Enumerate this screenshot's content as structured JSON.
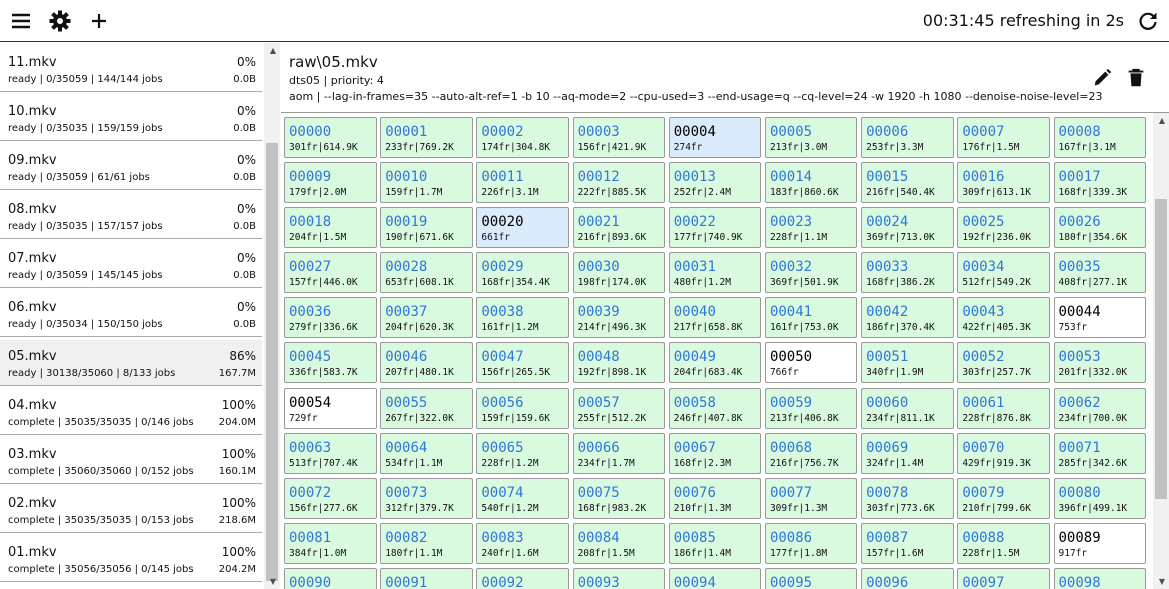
{
  "topbar": {
    "timer": "00:31:45",
    "refresh_text": "refreshing in 2s"
  },
  "sidebar": {
    "files": [
      {
        "name": "11.mkv",
        "pct": "0%",
        "status": "ready | 0/35059 | 144/144 jobs",
        "size": "0.0B"
      },
      {
        "name": "10.mkv",
        "pct": "0%",
        "status": "ready | 0/35035 | 159/159 jobs",
        "size": "0.0B"
      },
      {
        "name": "09.mkv",
        "pct": "0%",
        "status": "ready | 0/35059 | 61/61 jobs",
        "size": "0.0B"
      },
      {
        "name": "08.mkv",
        "pct": "0%",
        "status": "ready | 0/35035 | 157/157 jobs",
        "size": "0.0B"
      },
      {
        "name": "07.mkv",
        "pct": "0%",
        "status": "ready | 0/35059 | 145/145 jobs",
        "size": "0.0B"
      },
      {
        "name": "06.mkv",
        "pct": "0%",
        "status": "ready | 0/35034 | 150/150 jobs",
        "size": "0.0B"
      },
      {
        "name": "05.mkv",
        "pct": "86%",
        "status": "ready | 30138/35060 | 8/133 jobs",
        "size": "167.7M"
      },
      {
        "name": "04.mkv",
        "pct": "100%",
        "status": "complete | 35035/35035 | 0/146 jobs",
        "size": "204.0M"
      },
      {
        "name": "03.mkv",
        "pct": "100%",
        "status": "complete | 35060/35060 | 0/152 jobs",
        "size": "160.1M"
      },
      {
        "name": "02.mkv",
        "pct": "100%",
        "status": "complete | 35035/35035 | 0/153 jobs",
        "size": "218.6M"
      },
      {
        "name": "01.mkv",
        "pct": "100%",
        "status": "complete | 35056/35056 | 0/145 jobs",
        "size": "204.2M"
      }
    ]
  },
  "detail": {
    "title": "raw\\05.mkv",
    "subtitle": "dts05 | priority: 4",
    "command": "aom | --lag-in-frames=35 --auto-alt-ref=1 -b 10 --aq-mode=2 --cpu-used=3 --end-usage=q --cq-level=24 -w 1920 -h 1080 --denoise-noise-level=23"
  },
  "chunks": [
    {
      "id": "00000",
      "info": "301fr|614.9K",
      "state": "done"
    },
    {
      "id": "00001",
      "info": "233fr|769.2K",
      "state": "done"
    },
    {
      "id": "00002",
      "info": "174fr|304.8K",
      "state": "done"
    },
    {
      "id": "00003",
      "info": "156fr|421.9K",
      "state": "done"
    },
    {
      "id": "00004",
      "info": "274fr",
      "state": "active"
    },
    {
      "id": "00005",
      "info": "213fr|3.0M",
      "state": "done"
    },
    {
      "id": "00006",
      "info": "253fr|3.3M",
      "state": "done"
    },
    {
      "id": "00007",
      "info": "176fr|1.5M",
      "state": "done"
    },
    {
      "id": "00008",
      "info": "167fr|3.1M",
      "state": "done"
    },
    {
      "id": "00009",
      "info": "179fr|2.0M",
      "state": "done"
    },
    {
      "id": "00010",
      "info": "159fr|1.7M",
      "state": "done"
    },
    {
      "id": "00011",
      "info": "226fr|3.1M",
      "state": "done"
    },
    {
      "id": "00012",
      "info": "222fr|885.5K",
      "state": "done"
    },
    {
      "id": "00013",
      "info": "252fr|2.4M",
      "state": "done"
    },
    {
      "id": "00014",
      "info": "183fr|860.6K",
      "state": "done"
    },
    {
      "id": "00015",
      "info": "216fr|540.4K",
      "state": "done"
    },
    {
      "id": "00016",
      "info": "309fr|613.1K",
      "state": "done"
    },
    {
      "id": "00017",
      "info": "168fr|339.3K",
      "state": "done"
    },
    {
      "id": "00018",
      "info": "204fr|1.5M",
      "state": "done"
    },
    {
      "id": "00019",
      "info": "190fr|671.6K",
      "state": "done"
    },
    {
      "id": "00020",
      "info": "661fr",
      "state": "active"
    },
    {
      "id": "00021",
      "info": "216fr|893.6K",
      "state": "done"
    },
    {
      "id": "00022",
      "info": "177fr|740.9K",
      "state": "done"
    },
    {
      "id": "00023",
      "info": "228fr|1.1M",
      "state": "done"
    },
    {
      "id": "00024",
      "info": "369fr|713.0K",
      "state": "done"
    },
    {
      "id": "00025",
      "info": "192fr|236.0K",
      "state": "done"
    },
    {
      "id": "00026",
      "info": "180fr|354.6K",
      "state": "done"
    },
    {
      "id": "00027",
      "info": "157fr|446.0K",
      "state": "done"
    },
    {
      "id": "00028",
      "info": "653fr|608.1K",
      "state": "done"
    },
    {
      "id": "00029",
      "info": "168fr|354.4K",
      "state": "done"
    },
    {
      "id": "00030",
      "info": "198fr|174.0K",
      "state": "done"
    },
    {
      "id": "00031",
      "info": "480fr|1.2M",
      "state": "done"
    },
    {
      "id": "00032",
      "info": "369fr|501.9K",
      "state": "done"
    },
    {
      "id": "00033",
      "info": "168fr|386.2K",
      "state": "done"
    },
    {
      "id": "00034",
      "info": "512fr|549.2K",
      "state": "done"
    },
    {
      "id": "00035",
      "info": "408fr|277.1K",
      "state": "done"
    },
    {
      "id": "00036",
      "info": "279fr|336.6K",
      "state": "done"
    },
    {
      "id": "00037",
      "info": "204fr|620.3K",
      "state": "done"
    },
    {
      "id": "00038",
      "info": "161fr|1.2M",
      "state": "done"
    },
    {
      "id": "00039",
      "info": "214fr|496.3K",
      "state": "done"
    },
    {
      "id": "00040",
      "info": "217fr|658.8K",
      "state": "done"
    },
    {
      "id": "00041",
      "info": "161fr|753.0K",
      "state": "done"
    },
    {
      "id": "00042",
      "info": "186fr|370.4K",
      "state": "done"
    },
    {
      "id": "00043",
      "info": "422fr|405.3K",
      "state": "done"
    },
    {
      "id": "00044",
      "info": "753fr",
      "state": "queued"
    },
    {
      "id": "00045",
      "info": "336fr|583.7K",
      "state": "done"
    },
    {
      "id": "00046",
      "info": "207fr|480.1K",
      "state": "done"
    },
    {
      "id": "00047",
      "info": "156fr|265.5K",
      "state": "done"
    },
    {
      "id": "00048",
      "info": "192fr|898.1K",
      "state": "done"
    },
    {
      "id": "00049",
      "info": "204fr|683.4K",
      "state": "done"
    },
    {
      "id": "00050",
      "info": "766fr",
      "state": "queued"
    },
    {
      "id": "00051",
      "info": "340fr|1.9M",
      "state": "done"
    },
    {
      "id": "00052",
      "info": "303fr|257.7K",
      "state": "done"
    },
    {
      "id": "00053",
      "info": "201fr|332.0K",
      "state": "done"
    },
    {
      "id": "00054",
      "info": "729fr",
      "state": "queued"
    },
    {
      "id": "00055",
      "info": "267fr|322.0K",
      "state": "done"
    },
    {
      "id": "00056",
      "info": "159fr|159.6K",
      "state": "done"
    },
    {
      "id": "00057",
      "info": "255fr|512.2K",
      "state": "done"
    },
    {
      "id": "00058",
      "info": "246fr|407.8K",
      "state": "done"
    },
    {
      "id": "00059",
      "info": "213fr|406.8K",
      "state": "done"
    },
    {
      "id": "00060",
      "info": "234fr|811.1K",
      "state": "done"
    },
    {
      "id": "00061",
      "info": "228fr|876.8K",
      "state": "done"
    },
    {
      "id": "00062",
      "info": "234fr|700.0K",
      "state": "done"
    },
    {
      "id": "00063",
      "info": "513fr|707.4K",
      "state": "done"
    },
    {
      "id": "00064",
      "info": "534fr|1.1M",
      "state": "done"
    },
    {
      "id": "00065",
      "info": "228fr|1.2M",
      "state": "done"
    },
    {
      "id": "00066",
      "info": "234fr|1.7M",
      "state": "done"
    },
    {
      "id": "00067",
      "info": "168fr|2.3M",
      "state": "done"
    },
    {
      "id": "00068",
      "info": "216fr|756.7K",
      "state": "done"
    },
    {
      "id": "00069",
      "info": "324fr|1.4M",
      "state": "done"
    },
    {
      "id": "00070",
      "info": "429fr|919.3K",
      "state": "done"
    },
    {
      "id": "00071",
      "info": "285fr|342.6K",
      "state": "done"
    },
    {
      "id": "00072",
      "info": "156fr|277.6K",
      "state": "done"
    },
    {
      "id": "00073",
      "info": "312fr|379.7K",
      "state": "done"
    },
    {
      "id": "00074",
      "info": "540fr|1.2M",
      "state": "done"
    },
    {
      "id": "00075",
      "info": "168fr|983.2K",
      "state": "done"
    },
    {
      "id": "00076",
      "info": "210fr|1.3M",
      "state": "done"
    },
    {
      "id": "00077",
      "info": "309fr|1.3M",
      "state": "done"
    },
    {
      "id": "00078",
      "info": "303fr|773.6K",
      "state": "done"
    },
    {
      "id": "00079",
      "info": "210fr|799.6K",
      "state": "done"
    },
    {
      "id": "00080",
      "info": "396fr|499.1K",
      "state": "done"
    },
    {
      "id": "00081",
      "info": "384fr|1.0M",
      "state": "done"
    },
    {
      "id": "00082",
      "info": "180fr|1.1M",
      "state": "done"
    },
    {
      "id": "00083",
      "info": "240fr|1.6M",
      "state": "done"
    },
    {
      "id": "00084",
      "info": "208fr|1.5M",
      "state": "done"
    },
    {
      "id": "00085",
      "info": "186fr|1.4M",
      "state": "done"
    },
    {
      "id": "00086",
      "info": "177fr|1.8M",
      "state": "done"
    },
    {
      "id": "00087",
      "info": "157fr|1.6M",
      "state": "done"
    },
    {
      "id": "00088",
      "info": "228fr|1.5M",
      "state": "done"
    },
    {
      "id": "00089",
      "info": "917fr",
      "state": "queued"
    },
    {
      "id": "00090",
      "info": "",
      "state": "done"
    },
    {
      "id": "00091",
      "info": "",
      "state": "done"
    },
    {
      "id": "00092",
      "info": "",
      "state": "done"
    },
    {
      "id": "00093",
      "info": "",
      "state": "done"
    },
    {
      "id": "00094",
      "info": "",
      "state": "done"
    },
    {
      "id": "00095",
      "info": "",
      "state": "done"
    },
    {
      "id": "00096",
      "info": "",
      "state": "done"
    },
    {
      "id": "00097",
      "info": "",
      "state": "done"
    },
    {
      "id": "00098",
      "info": "",
      "state": "done"
    }
  ],
  "colors": {
    "done_bg": "#d9fade",
    "active_bg": "#daecfb",
    "queued_bg": "#ffffff",
    "chunk_id_done": "#2f78d6"
  }
}
